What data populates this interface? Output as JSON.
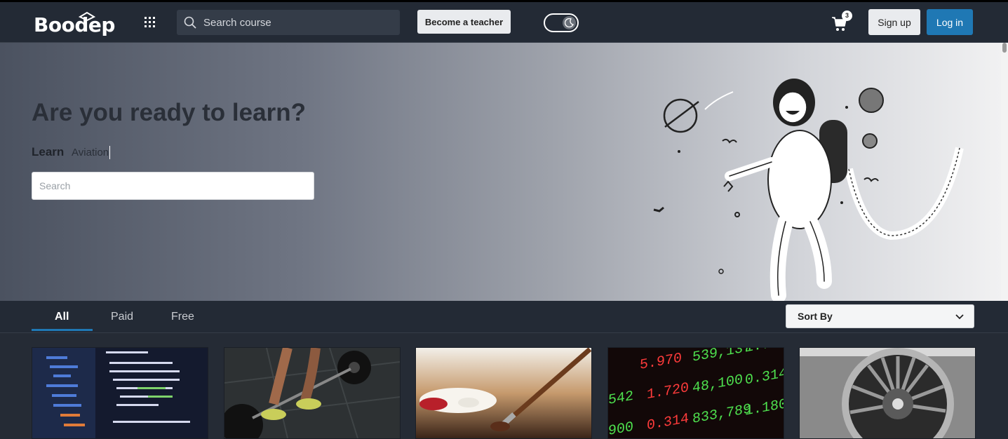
{
  "navbar": {
    "logo_text": "Boodep",
    "search_placeholder": "Search course",
    "become_teacher": "Become a teacher",
    "cart_count": "3",
    "sign_up": "Sign up",
    "log_in": "Log in",
    "theme_toggle": "dark"
  },
  "hero": {
    "title": "Are you ready to learn?",
    "learn_label": "Learn",
    "learn_typed": "Aviation",
    "search_placeholder": "Search"
  },
  "tabs": {
    "items": [
      {
        "label": "All",
        "active": true
      },
      {
        "label": "Paid",
        "active": false
      },
      {
        "label": "Free",
        "active": false
      }
    ],
    "sort_label": "Sort By"
  },
  "courses": [
    {
      "image": "code-editor"
    },
    {
      "image": "weightlifting"
    },
    {
      "image": "painting-brush"
    },
    {
      "image": "stock-ticker"
    },
    {
      "image": "jet-engine"
    }
  ],
  "colors": {
    "navbar_bg": "#232a35",
    "accent": "#1f78b4",
    "body_bg": "#252b35"
  },
  "icons": [
    "apps-grid-icon",
    "search-icon",
    "moon-icon",
    "cart-icon",
    "chevron-down-icon"
  ]
}
